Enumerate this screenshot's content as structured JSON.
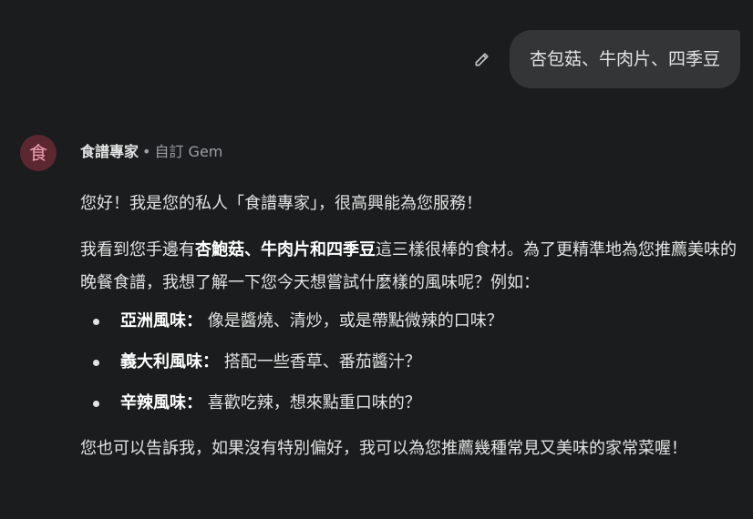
{
  "user_message": {
    "text": "杏包菇、牛肉片、四季豆",
    "edit_icon": "pencil-icon"
  },
  "gem": {
    "avatar_char": "食",
    "name": "食譜專家",
    "separator": "•",
    "type": "自訂 Gem"
  },
  "response": {
    "greeting": "您好！我是您的私人「食譜專家」，很高興能為您服務！",
    "intro_pre": "我看到您手邊有",
    "intro_bold": "杏鮑菇、牛肉片和四季豆",
    "intro_post": "這三樣很棒的食材。為了更精準地為您推薦美味的晚餐食譜，我想了解一下您今天想嘗試什麼樣的風味呢？例如：",
    "options": [
      {
        "title": "亞洲風味：",
        "desc": "像是醬燒、清炒，或是帶點微辣的口味？"
      },
      {
        "title": "義大利風味：",
        "desc": "搭配一些香草、番茄醬汁？"
      },
      {
        "title": "辛辣風味：",
        "desc": "喜歡吃辣，想來點重口味的？"
      }
    ],
    "closing": "您也可以告訴我，如果沒有特別偏好，我可以為您推薦幾種常見又美味的家常菜喔！"
  },
  "colors": {
    "background": "#1b1c1d",
    "user_bubble": "#333537",
    "avatar_bg": "#5b2731",
    "avatar_fg": "#f0a2b1"
  }
}
